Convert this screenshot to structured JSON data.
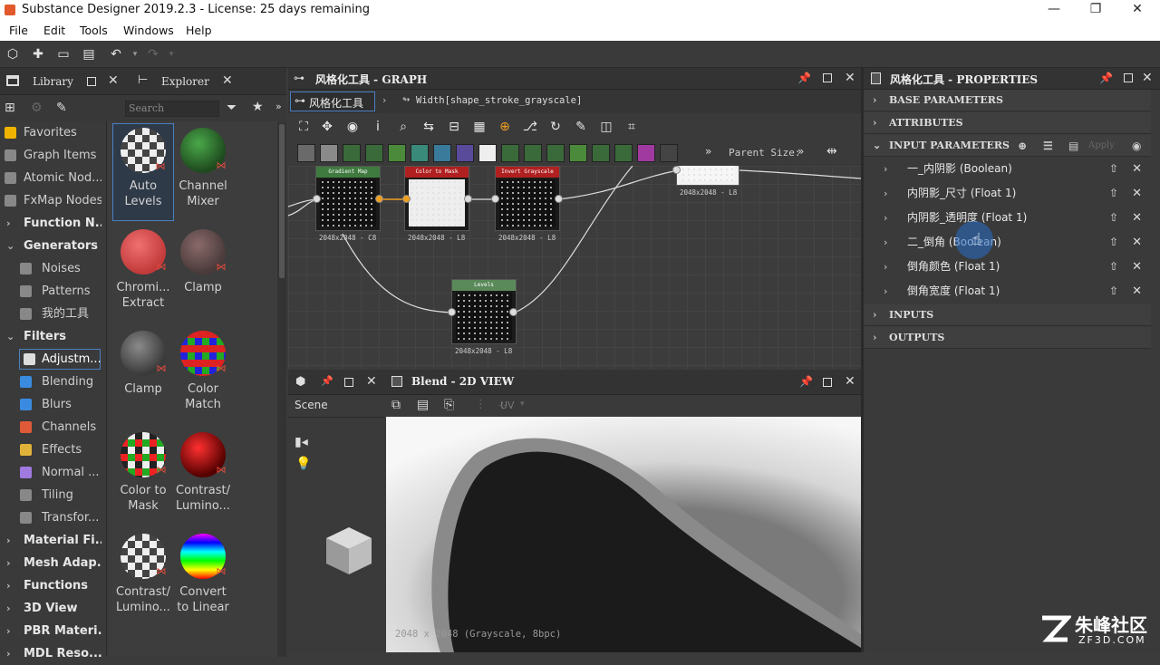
{
  "window": {
    "title": "Substance Designer 2019.2.3 - License: 25 days remaining",
    "minimize": "—",
    "restore": "❐",
    "close": "✕"
  },
  "menu": [
    "File",
    "Edit",
    "Tools",
    "Windows",
    "Help"
  ],
  "library": {
    "tab_library": "Library",
    "tab_explorer": "Explorer",
    "search_placeholder": "Search",
    "items": [
      {
        "label": "Favorites",
        "type": "item",
        "color": "#f0b400"
      },
      {
        "label": "Graph Items",
        "type": "item",
        "color": "#888"
      },
      {
        "label": "Atomic Nod...",
        "type": "item",
        "color": "#888"
      },
      {
        "label": "FxMap Nodes",
        "type": "item",
        "color": "#888"
      },
      {
        "label": "Function N...",
        "type": "group-collapsed"
      },
      {
        "label": "Generators",
        "type": "group-open"
      },
      {
        "label": "Noises",
        "type": "sub",
        "color": "#888"
      },
      {
        "label": "Patterns",
        "type": "sub",
        "color": "#888"
      },
      {
        "label": "我的工具",
        "type": "sub",
        "color": "#888"
      },
      {
        "label": "Filters",
        "type": "group-open"
      },
      {
        "label": "Adjustm...",
        "type": "sub-selected",
        "color": "#ddd"
      },
      {
        "label": "Blending",
        "type": "sub",
        "color": "#3a8be0"
      },
      {
        "label": "Blurs",
        "type": "sub",
        "color": "#3a8be0"
      },
      {
        "label": "Channels",
        "type": "sub",
        "color": "#e05a3a"
      },
      {
        "label": "Effects",
        "type": "sub",
        "color": "#e0b23a"
      },
      {
        "label": "Normal ...",
        "type": "sub",
        "color": "#a07ae0"
      },
      {
        "label": "Tiling",
        "type": "sub",
        "color": "#888"
      },
      {
        "label": "Transfor...",
        "type": "sub",
        "color": "#888"
      },
      {
        "label": "Material Fi...",
        "type": "group-collapsed"
      },
      {
        "label": "Mesh Adap...",
        "type": "group-collapsed"
      },
      {
        "label": "Functions",
        "type": "group-collapsed"
      },
      {
        "label": "3D View",
        "type": "group-collapsed"
      },
      {
        "label": "PBR Materi...",
        "type": "group-collapsed"
      },
      {
        "label": "MDL Reso...",
        "type": "group-collapsed"
      }
    ],
    "thumbs": [
      {
        "label": "Auto\nLevels",
        "style": "checker-gray",
        "selected": true
      },
      {
        "label": "Channel\nMixer",
        "style": "green"
      },
      {
        "label": "Chromi...\nExtract",
        "style": "red"
      },
      {
        "label": "Clamp",
        "style": "gray-red"
      },
      {
        "label": "Clamp",
        "style": "gray"
      },
      {
        "label": "Color\nMatch",
        "style": "checker-rgb"
      },
      {
        "label": "Color to\nMask",
        "style": "checker-green"
      },
      {
        "label": "Contrast/\nLumino...",
        "style": "red-dark"
      },
      {
        "label": "Contrast/\nLumino...",
        "style": "checker-gray"
      },
      {
        "label": "Convert\nto Linear",
        "style": "rainbow"
      }
    ]
  },
  "graph": {
    "title": "风格化工具 - GRAPH",
    "crumb_root": "风格化工具",
    "crumb_child": "Width[shape_stroke_grayscale]",
    "parent_size": "Parent Size:",
    "nodes": [
      {
        "title": "Gradient Map",
        "size": "2048x2048 - C8",
        "color": "#3f7a3f"
      },
      {
        "title": "Color to Mask",
        "size": "2048x2048 - L8",
        "color": "#b02020"
      },
      {
        "title": "Invert Grayscale",
        "size": "2048x2048 - L8",
        "color": "#b02020"
      },
      {
        "title": "Levels",
        "size": "2048x2048 - L8",
        "color": "#5a8a5a"
      },
      {
        "title": "",
        "size": "2048x2048 - L8",
        "color": "#ddd"
      }
    ]
  },
  "scene": {
    "label": "Scene"
  },
  "view2d": {
    "title": "Blend - 2D VIEW",
    "uv": "UV",
    "status": "2048 x 2048 (Grayscale, 8bpc)"
  },
  "props": {
    "title": "风格化工具 - PROPERTIES",
    "sections": [
      "BASE PARAMETERS",
      "ATTRIBUTES",
      "INPUT PARAMETERS",
      "INPUTS",
      "OUTPUTS"
    ],
    "apply": "Apply",
    "params": [
      "一_内阴影 (Boolean)",
      "内阴影_尺寸 (Float 1)",
      "内阴影_透明度 (Float 1)",
      "二_倒角 (Boolean)",
      "倒角颜色 (Float 1)",
      "倒角宽度 (Float 1)"
    ]
  },
  "watermark": {
    "text": "朱峰社区",
    "url": "ZF3D.COM"
  }
}
